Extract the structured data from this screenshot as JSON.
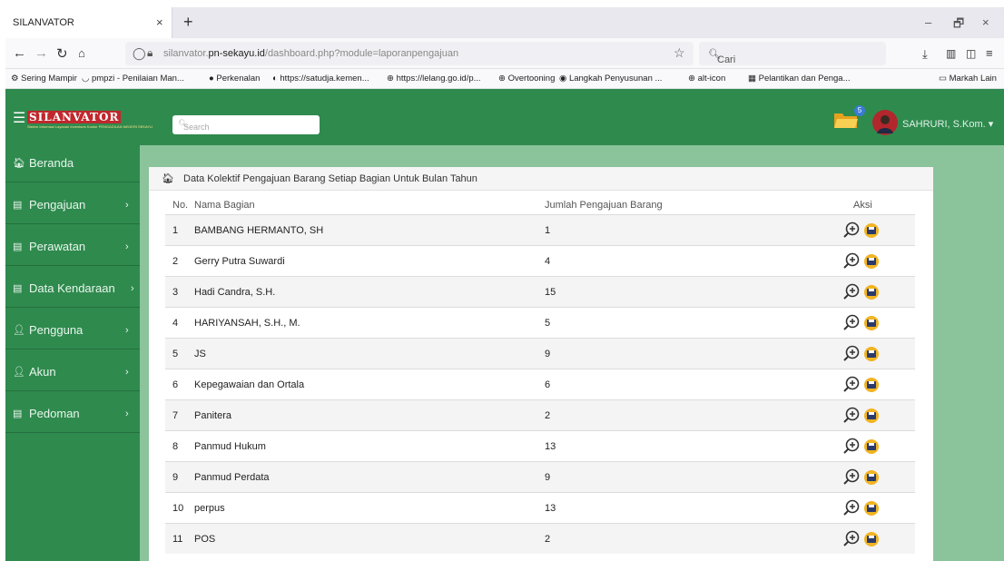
{
  "browser": {
    "tab_title": "SILANVATOR",
    "tab_close": "×",
    "new_tab": "+",
    "win_minimize": "–",
    "win_restore": "🗗",
    "win_close": "×",
    "url_prefix": "silanvator.",
    "url_domain": "pn-sekayu.id",
    "url_path": "/dashboard.php?module=laporanpengajuan",
    "search_placeholder": "Cari",
    "bookmarks": [
      "Sering Mampir",
      "pmpzi - Penilaian Man...",
      "Perkenalan",
      "https://satudja.kemen...",
      "https://lelang.go.id/p...",
      "Overtooning",
      "Langkah Penyusunan ...",
      "alt-icon",
      "Pelantikan dan Penga..."
    ],
    "other_bookmarks": "Markah Lain"
  },
  "app": {
    "logo": "SILANVATOR",
    "logo_subtitle": "Sistem Informasi Layanan Inventaris Kantor PENGADILAN NEGERI SEKAYU",
    "search_placeholder": "Search",
    "notification_count": "5",
    "user_name": "SAHRURI, S.Kom. ▾"
  },
  "sidebar": {
    "items": [
      {
        "label": "Beranda",
        "icon": "home-icon",
        "arrow": ""
      },
      {
        "label": "Pengajuan",
        "icon": "list-icon",
        "arrow": "›"
      },
      {
        "label": "Perawatan",
        "icon": "list-icon",
        "arrow": "›"
      },
      {
        "label": "Data Kendaraan",
        "icon": "list-icon",
        "arrow": "›"
      },
      {
        "label": "Pengguna",
        "icon": "user-icon",
        "arrow": "›"
      },
      {
        "label": "Akun",
        "icon": "user-icon",
        "arrow": "›"
      },
      {
        "label": "Pedoman",
        "icon": "list-icon",
        "arrow": "›"
      }
    ]
  },
  "panel": {
    "title": "Data Kolektif Pengajuan Barang Setiap Bagian Untuk Bulan Tahun",
    "columns": [
      "No.",
      "Nama Bagian",
      "Jumlah Pengajuan Barang",
      "Aksi"
    ],
    "rows": [
      {
        "no": "1",
        "name": "BAMBANG HERMANTO, SH",
        "count": "1"
      },
      {
        "no": "2",
        "name": "Gerry Putra Suwardi",
        "count": "4"
      },
      {
        "no": "3",
        "name": "Hadi Candra, S.H.",
        "count": "15"
      },
      {
        "no": "4",
        "name": "HARIYANSAH, S.H., M.",
        "count": "5"
      },
      {
        "no": "5",
        "name": "JS",
        "count": "9"
      },
      {
        "no": "6",
        "name": "Kepegawaian dan Ortala",
        "count": "6"
      },
      {
        "no": "7",
        "name": "Panitera",
        "count": "2"
      },
      {
        "no": "8",
        "name": "Panmud Hukum",
        "count": "13"
      },
      {
        "no": "9",
        "name": "Panmud Perdata",
        "count": "9"
      },
      {
        "no": "10",
        "name": "perpus",
        "count": "13"
      },
      {
        "no": "11",
        "name": "POS",
        "count": "2"
      }
    ]
  },
  "colors": {
    "header_green": "#2f8a4e",
    "content_bg": "#8bc49a",
    "logo_red": "#c0282d",
    "badge_blue": "#3a7bd5",
    "save_icon_yellow": "#f1b422"
  }
}
